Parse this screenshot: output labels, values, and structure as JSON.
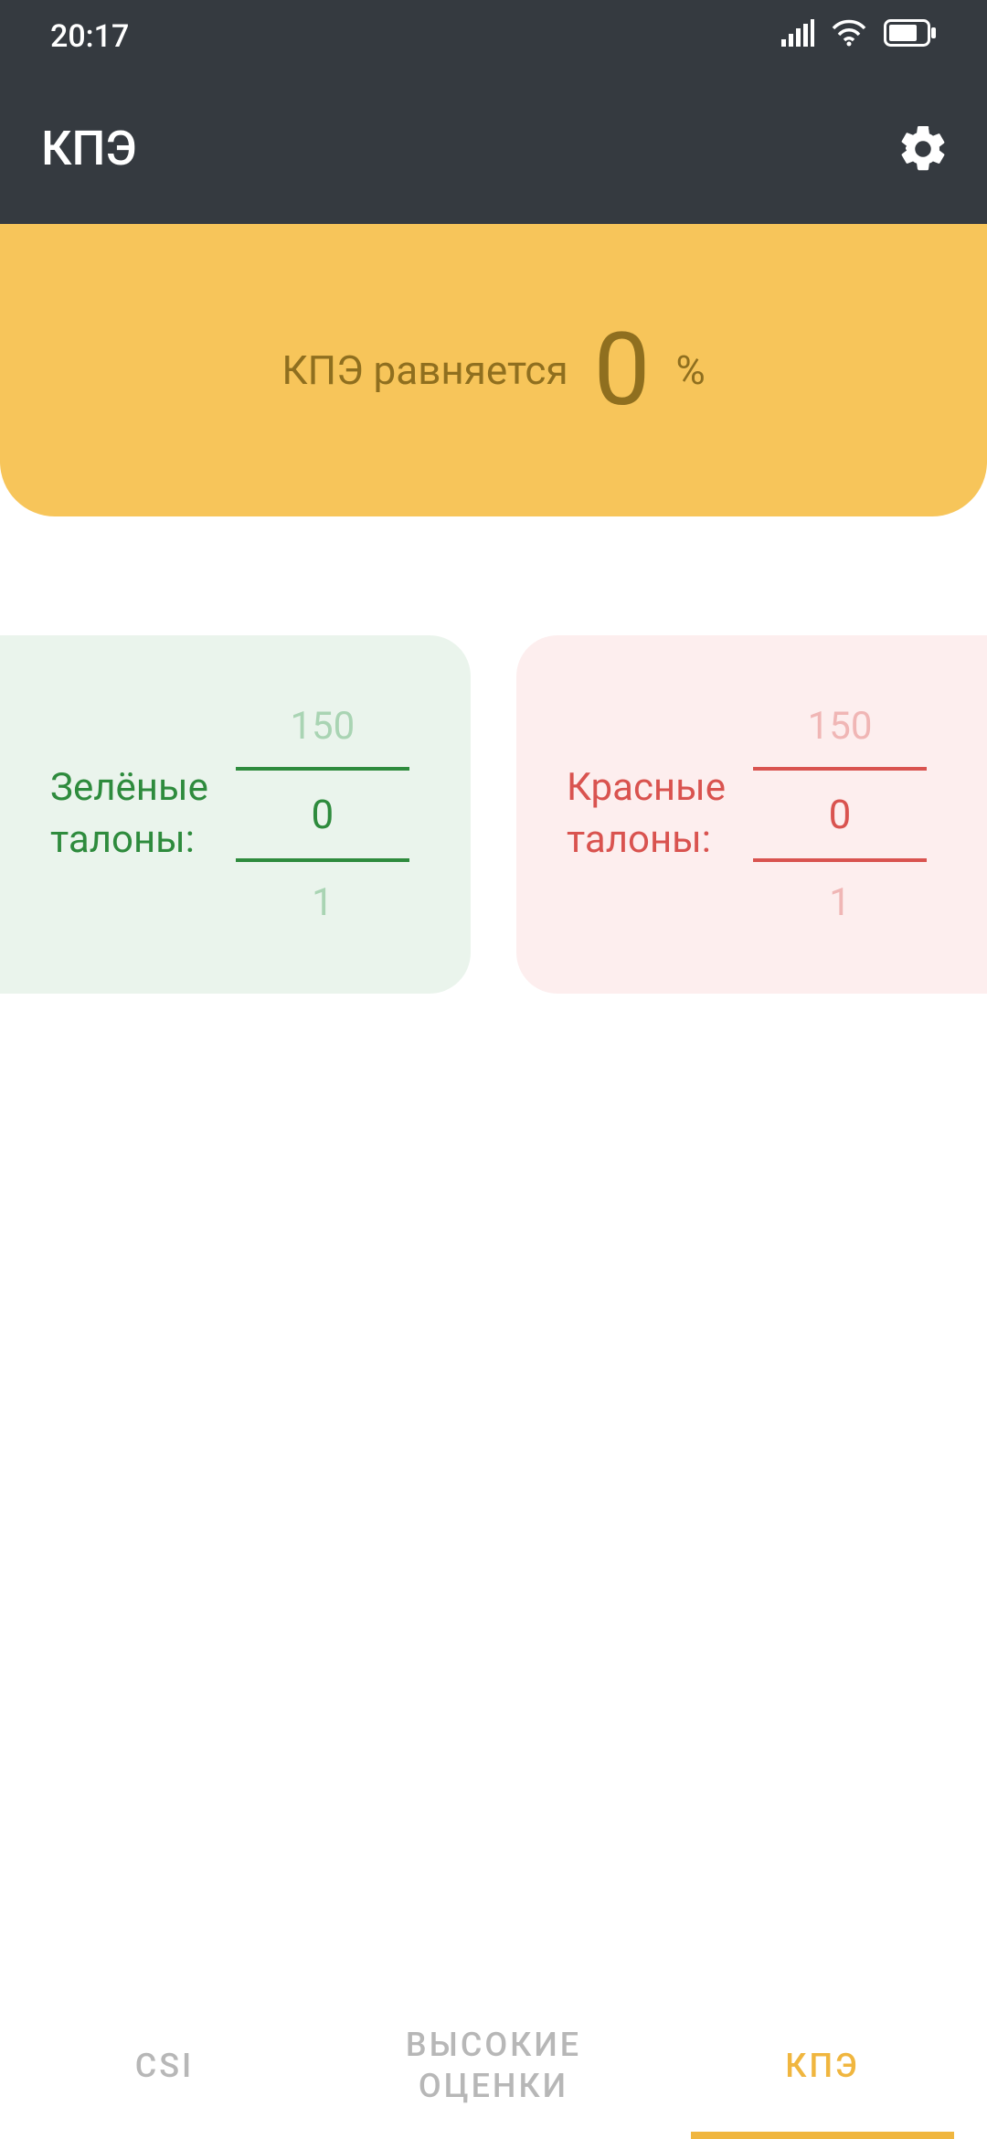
{
  "status": {
    "time": "20:17"
  },
  "appbar": {
    "title": "КПЭ"
  },
  "hero": {
    "label": "КПЭ равняется",
    "value": "0",
    "unit": "%"
  },
  "cards": {
    "green": {
      "label": "Зелёные\nталоны:",
      "prev": "150",
      "value": "0",
      "next": "1"
    },
    "red": {
      "label": "Красные\nталоны:",
      "prev": "150",
      "value": "0",
      "next": "1"
    }
  },
  "nav": {
    "items": [
      {
        "label": "CSI"
      },
      {
        "label": "ВЫСОКИЕ\nОЦЕНКИ"
      },
      {
        "label": "КПЭ"
      }
    ],
    "active_index": 2
  }
}
